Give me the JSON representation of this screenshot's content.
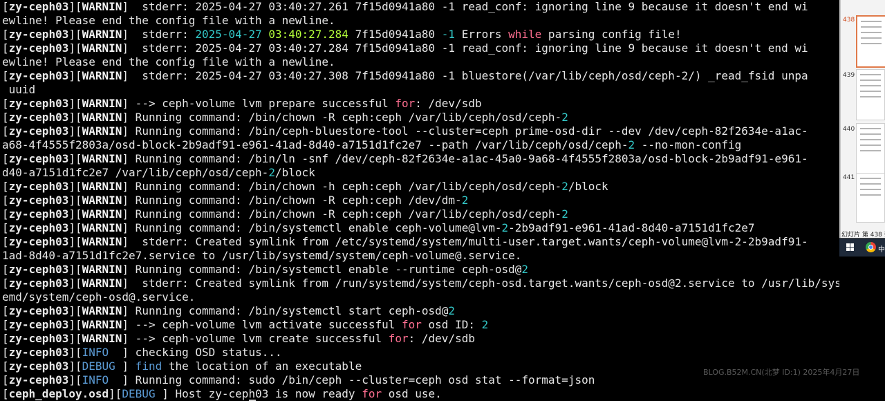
{
  "terminal": {
    "lines": [
      {
        "host": "zy-ceph03",
        "level": "WARNIN",
        "level_type": "warn",
        "segs": [
          [
            "  stderr: 2025-04-27 03:40:27.261 7f15d0941a80 -1 read_conf: ignoring line 9 because it doesn't end wi",
            ""
          ]
        ]
      },
      {
        "segs": [
          [
            "ewline! Please end the config file with a newline.",
            ""
          ]
        ]
      },
      {
        "host": "zy-ceph03",
        "level": "WARNIN",
        "level_type": "warn",
        "segs": [
          [
            "  stderr: ",
            ""
          ],
          [
            "2025-04-27",
            "cyan"
          ],
          [
            " ",
            ""
          ],
          [
            "03:40:27.284",
            "green"
          ],
          [
            " 7f15d0941a80 ",
            ""
          ],
          [
            "-1",
            "cyan"
          ],
          [
            " Errors ",
            ""
          ],
          [
            "while",
            "kw"
          ],
          [
            " parsing config file!",
            ""
          ]
        ]
      },
      {
        "host": "zy-ceph03",
        "level": "WARNIN",
        "level_type": "warn",
        "segs": [
          [
            "  stderr: 2025-04-27 03:40:27.284 7f15d0941a80 -1 read_conf: ignoring line 9 because it doesn't end wi",
            ""
          ]
        ]
      },
      {
        "segs": [
          [
            "ewline! Please end the config file with a newline.",
            ""
          ]
        ]
      },
      {
        "host": "zy-ceph03",
        "level": "WARNIN",
        "level_type": "warn",
        "segs": [
          [
            "  stderr: 2025-04-27 03:40:27.308 7f15d0941a80 -1 bluestore(/var/lib/ceph/osd/ceph-2/) _read_fsid unpa",
            ""
          ]
        ]
      },
      {
        "segs": [
          [
            " uuid",
            ""
          ]
        ]
      },
      {
        "host": "zy-ceph03",
        "level": "WARNIN",
        "level_type": "warn",
        "segs": [
          [
            " --> ceph-volume lvm prepare successful ",
            ""
          ],
          [
            "for",
            "kw"
          ],
          [
            ": /dev/sdb",
            ""
          ]
        ]
      },
      {
        "host": "zy-ceph03",
        "level": "WARNIN",
        "level_type": "warn",
        "segs": [
          [
            " Running command: /bin/chown -R ceph:ceph /var/lib/ceph/osd/ceph-",
            ""
          ],
          [
            "2",
            "cyan"
          ]
        ]
      },
      {
        "host": "zy-ceph03",
        "level": "WARNIN",
        "level_type": "warn",
        "segs": [
          [
            " Running command: /bin/ceph-bluestore-tool --cluster=ceph prime-osd-dir --dev /dev/ceph-82f2634e-a1ac-",
            ""
          ]
        ]
      },
      {
        "segs": [
          [
            "a68-4f4555f2803a/osd-block-2b9adf91-e961-41ad-8d40-a7151d1fc2e7 --path /var/lib/ceph/osd/ceph-",
            ""
          ],
          [
            "2",
            "cyan"
          ],
          [
            " --no-mon-config",
            ""
          ]
        ]
      },
      {
        "host": "zy-ceph03",
        "level": "WARNIN",
        "level_type": "warn",
        "segs": [
          [
            " Running command: /bin/ln -snf /dev/ceph-82f2634e-a1ac-45a0-9a68-4f4555f2803a/osd-block-2b9adf91-e961-",
            ""
          ]
        ]
      },
      {
        "segs": [
          [
            "d40-a7151d1fc2e7 /var/lib/ceph/osd/ceph-",
            ""
          ],
          [
            "2",
            "cyan"
          ],
          [
            "/block",
            ""
          ]
        ]
      },
      {
        "host": "zy-ceph03",
        "level": "WARNIN",
        "level_type": "warn",
        "segs": [
          [
            " Running command: /bin/chown -h ceph:ceph /var/lib/ceph/osd/ceph-",
            ""
          ],
          [
            "2",
            "cyan"
          ],
          [
            "/block",
            ""
          ]
        ]
      },
      {
        "host": "zy-ceph03",
        "level": "WARNIN",
        "level_type": "warn",
        "segs": [
          [
            " Running command: /bin/chown -R ceph:ceph /dev/dm-",
            ""
          ],
          [
            "2",
            "cyan"
          ]
        ]
      },
      {
        "host": "zy-ceph03",
        "level": "WARNIN",
        "level_type": "warn",
        "segs": [
          [
            " Running command: /bin/chown -R ceph:ceph /var/lib/ceph/osd/ceph-",
            ""
          ],
          [
            "2",
            "cyan"
          ]
        ]
      },
      {
        "host": "zy-ceph03",
        "level": "WARNIN",
        "level_type": "warn",
        "segs": [
          [
            " Running command: /bin/systemctl enable ceph-volume@lvm-",
            ""
          ],
          [
            "2",
            "cyan"
          ],
          [
            "-2b9adf91-e961-41ad-8d40-a7151d1fc2e7",
            ""
          ]
        ]
      },
      {
        "host": "zy-ceph03",
        "level": "WARNIN",
        "level_type": "warn",
        "segs": [
          [
            "  stderr: Created symlink from /etc/systemd/system/multi-user.target.wants/ceph-volume@lvm-2-2b9adf91-",
            ""
          ]
        ]
      },
      {
        "segs": [
          [
            "1ad-8d40-a7151d1fc2e7.service to /usr/lib/systemd/system/ceph-volume@.service.",
            ""
          ]
        ]
      },
      {
        "host": "zy-ceph03",
        "level": "WARNIN",
        "level_type": "warn",
        "segs": [
          [
            " Running command: /bin/systemctl enable --runtime ceph-osd@",
            ""
          ],
          [
            "2",
            "cyan"
          ]
        ]
      },
      {
        "host": "zy-ceph03",
        "level": "WARNIN",
        "level_type": "warn",
        "segs": [
          [
            "  stderr: Created symlink from /run/systemd/system/ceph-osd.target.wants/ceph-osd@2.service to /usr/lib/syst",
            ""
          ]
        ]
      },
      {
        "segs": [
          [
            "emd/system/ceph-osd@.service.",
            ""
          ]
        ]
      },
      {
        "host": "zy-ceph03",
        "level": "WARNIN",
        "level_type": "warn",
        "segs": [
          [
            " Running command: /bin/systemctl start ceph-osd@",
            ""
          ],
          [
            "2",
            "cyan"
          ]
        ]
      },
      {
        "host": "zy-ceph03",
        "level": "WARNIN",
        "level_type": "warn",
        "segs": [
          [
            " --> ceph-volume lvm activate successful ",
            ""
          ],
          [
            "for",
            "kw"
          ],
          [
            " osd ID: ",
            ""
          ],
          [
            "2",
            "cyan"
          ]
        ]
      },
      {
        "host": "zy-ceph03",
        "level": "WARNIN",
        "level_type": "warn",
        "segs": [
          [
            " --> ceph-volume lvm create successful ",
            ""
          ],
          [
            "for",
            "kw"
          ],
          [
            ": /dev/sdb",
            ""
          ]
        ]
      },
      {
        "host": "zy-ceph03",
        "level": "INFO  ",
        "level_type": "info",
        "segs": [
          [
            " checking OSD status...",
            ""
          ]
        ]
      },
      {
        "host": "zy-ceph03",
        "level": "DEBUG ",
        "level_type": "debug",
        "segs": [
          [
            " ",
            ""
          ],
          [
            "find",
            "find"
          ],
          [
            " the location of an executable",
            ""
          ]
        ]
      },
      {
        "host": "zy-ceph03",
        "level": "INFO  ",
        "level_type": "info",
        "segs": [
          [
            " Running command: sudo /bin/ceph --cluster=ceph osd stat --format=json",
            ""
          ]
        ]
      },
      {
        "host": "ceph_deploy.osd",
        "level": "DEBUG ",
        "level_type": "debug",
        "segs": [
          [
            " Host zy-ceph03 is now ready ",
            ""
          ],
          [
            "for",
            "kw"
          ],
          [
            " osd use.",
            ""
          ]
        ]
      }
    ]
  },
  "side_panel": {
    "slide_numbers": [
      "438",
      "439",
      "440",
      "441"
    ],
    "active_slide": "438",
    "status_text": "幻灯片 第 438 张"
  },
  "taskbar": {
    "start_icon": "windows-logo-icon",
    "browser_icon": "chrome-icon",
    "app_label": "中"
  },
  "watermark": "BLOG.B52M.CN(北梦 ID:1) 2025年4月27日",
  "colors": {
    "background": "#000000",
    "text": "#e6e6e6",
    "cyan": "#33c9c9",
    "green": "#b4ff3a",
    "keyword": "#ff6f91",
    "info_debug": "#5b9bd5",
    "panel_active": "#e07a4a"
  }
}
